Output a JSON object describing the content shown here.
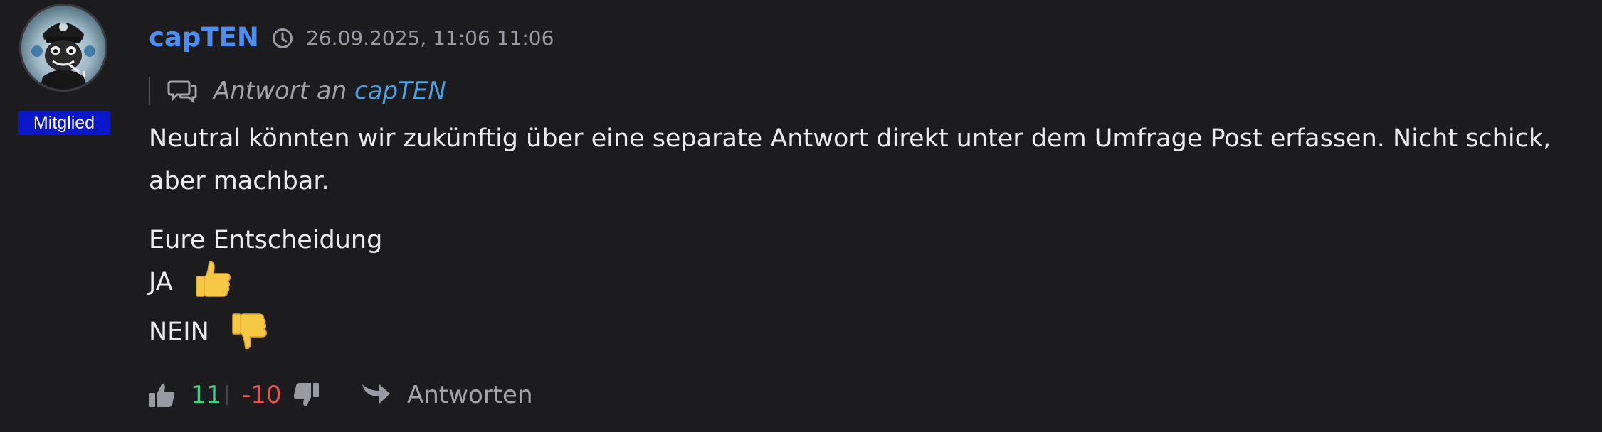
{
  "post": {
    "author": "capTEN",
    "role": "Mitglied",
    "timestamp": "26.09.2025, 11:06 11:06",
    "reply_to": {
      "prefix": "Antwort an",
      "author": "capTEN"
    },
    "body": {
      "paragraph": "Neutral könnten wir zukünftig über eine separate Antwort direkt unter dem Umfrage Post erfassen. Nicht schick, aber machbar.",
      "decision_heading": "Eure Entscheidung",
      "option_yes": "JA",
      "option_no": "NEIN"
    },
    "votes": {
      "up": "11",
      "down": "-10"
    },
    "actions": {
      "reply_label": "Antworten"
    }
  },
  "colors": {
    "background": "#1c1c1f",
    "author_link": "#4d8ff0",
    "reply_author": "#4ba3df",
    "role_badge": "#0a18c9",
    "upvote": "#3fcf8a",
    "downvote": "#e25555"
  },
  "icons": {
    "timestamp": "clock-icon",
    "reply_to": "chat-bubbles-icon",
    "yes": "thumbs-up-emoji",
    "no": "thumbs-down-emoji",
    "upvote": "thumbs-up-icon",
    "downvote": "thumbs-down-icon",
    "reply": "share-arrow-icon"
  }
}
